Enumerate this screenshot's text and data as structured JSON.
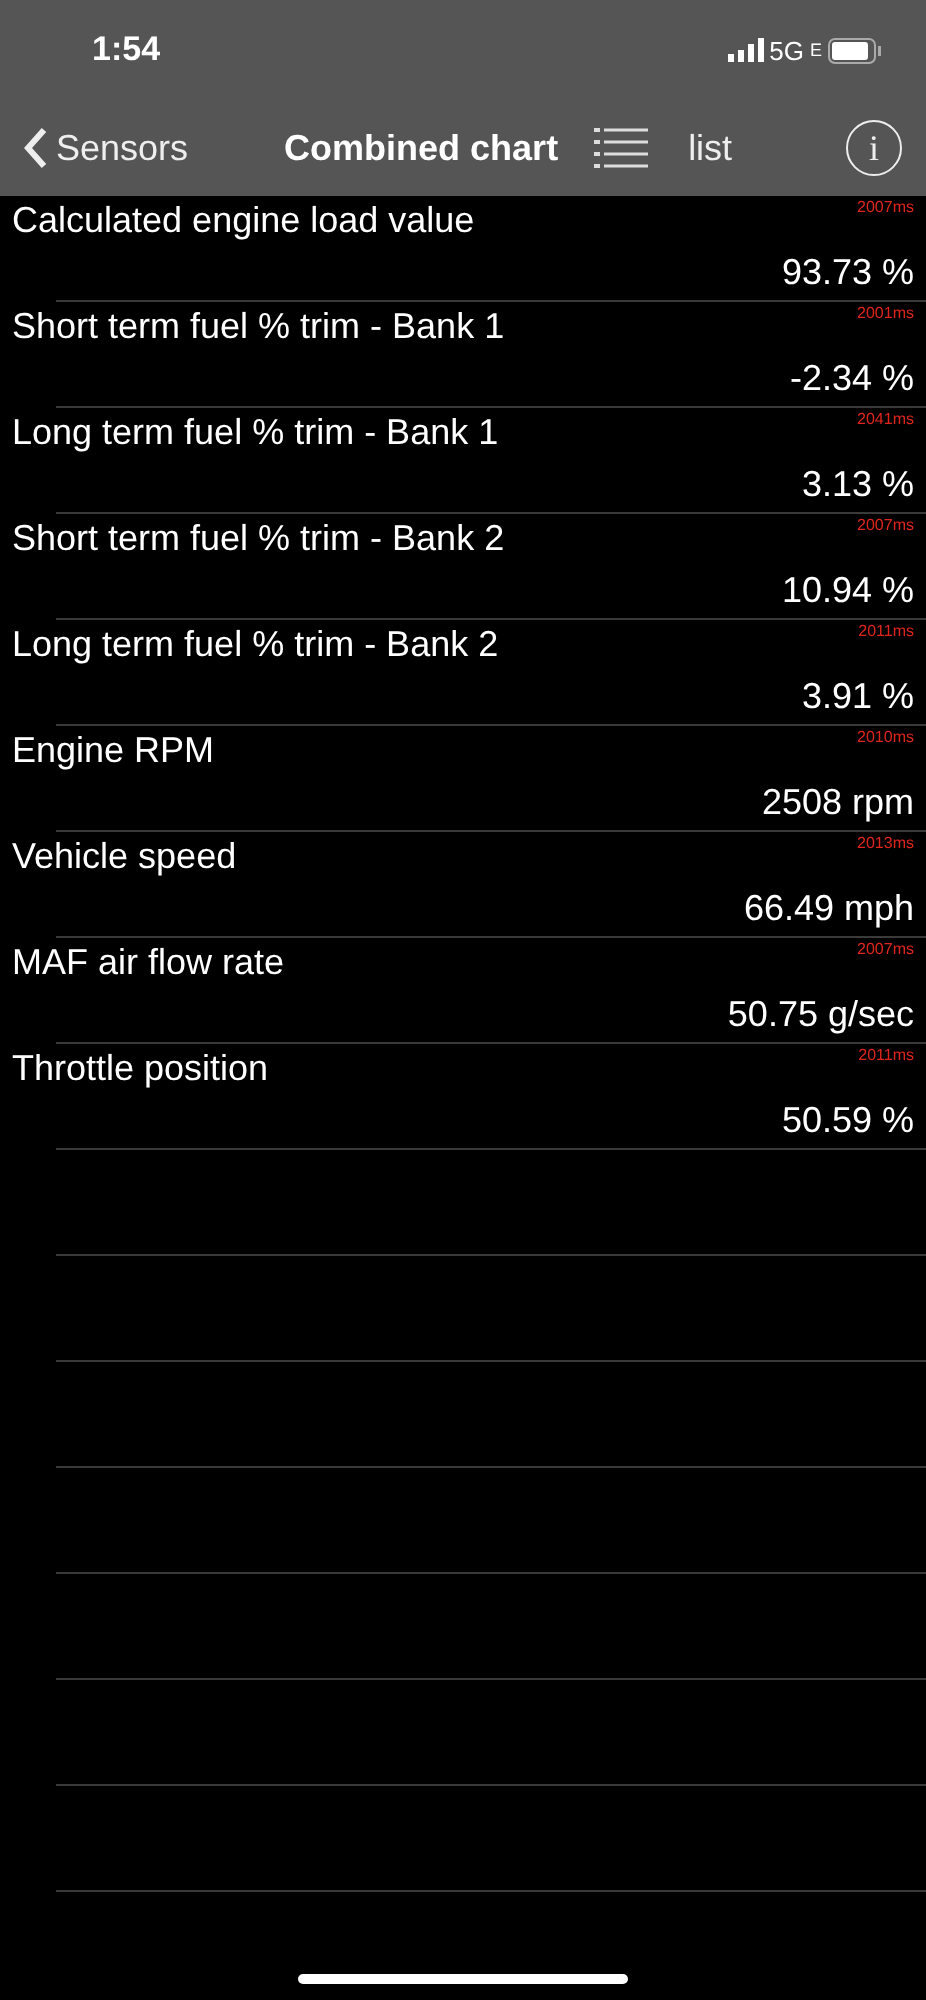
{
  "status_bar": {
    "time": "1:54",
    "network": "5G",
    "network_suffix": "E"
  },
  "nav": {
    "back": "Sensors",
    "title": "Combined chart",
    "list": "list",
    "info": "i"
  },
  "sensors": [
    {
      "name": "Calculated engine load value",
      "value": "93.73 %",
      "interval": "2007ms"
    },
    {
      "name": "Short term fuel % trim - Bank 1",
      "value": "-2.34 %",
      "interval": "2001ms"
    },
    {
      "name": "Long term fuel % trim - Bank 1",
      "value": "3.13 %",
      "interval": "2041ms"
    },
    {
      "name": "Short term fuel % trim - Bank 2",
      "value": "10.94 %",
      "interval": "2007ms"
    },
    {
      "name": "Long term fuel % trim - Bank 2",
      "value": "3.91 %",
      "interval": "2011ms"
    },
    {
      "name": "Engine RPM",
      "value": "2508 rpm",
      "interval": "2010ms"
    },
    {
      "name": "Vehicle speed",
      "value": "66.49 mph",
      "interval": "2013ms"
    },
    {
      "name": "MAF air flow rate",
      "value": "50.75 g/sec",
      "interval": "2007ms"
    },
    {
      "name": "Throttle position",
      "value": "50.59 %",
      "interval": "2011ms"
    }
  ]
}
